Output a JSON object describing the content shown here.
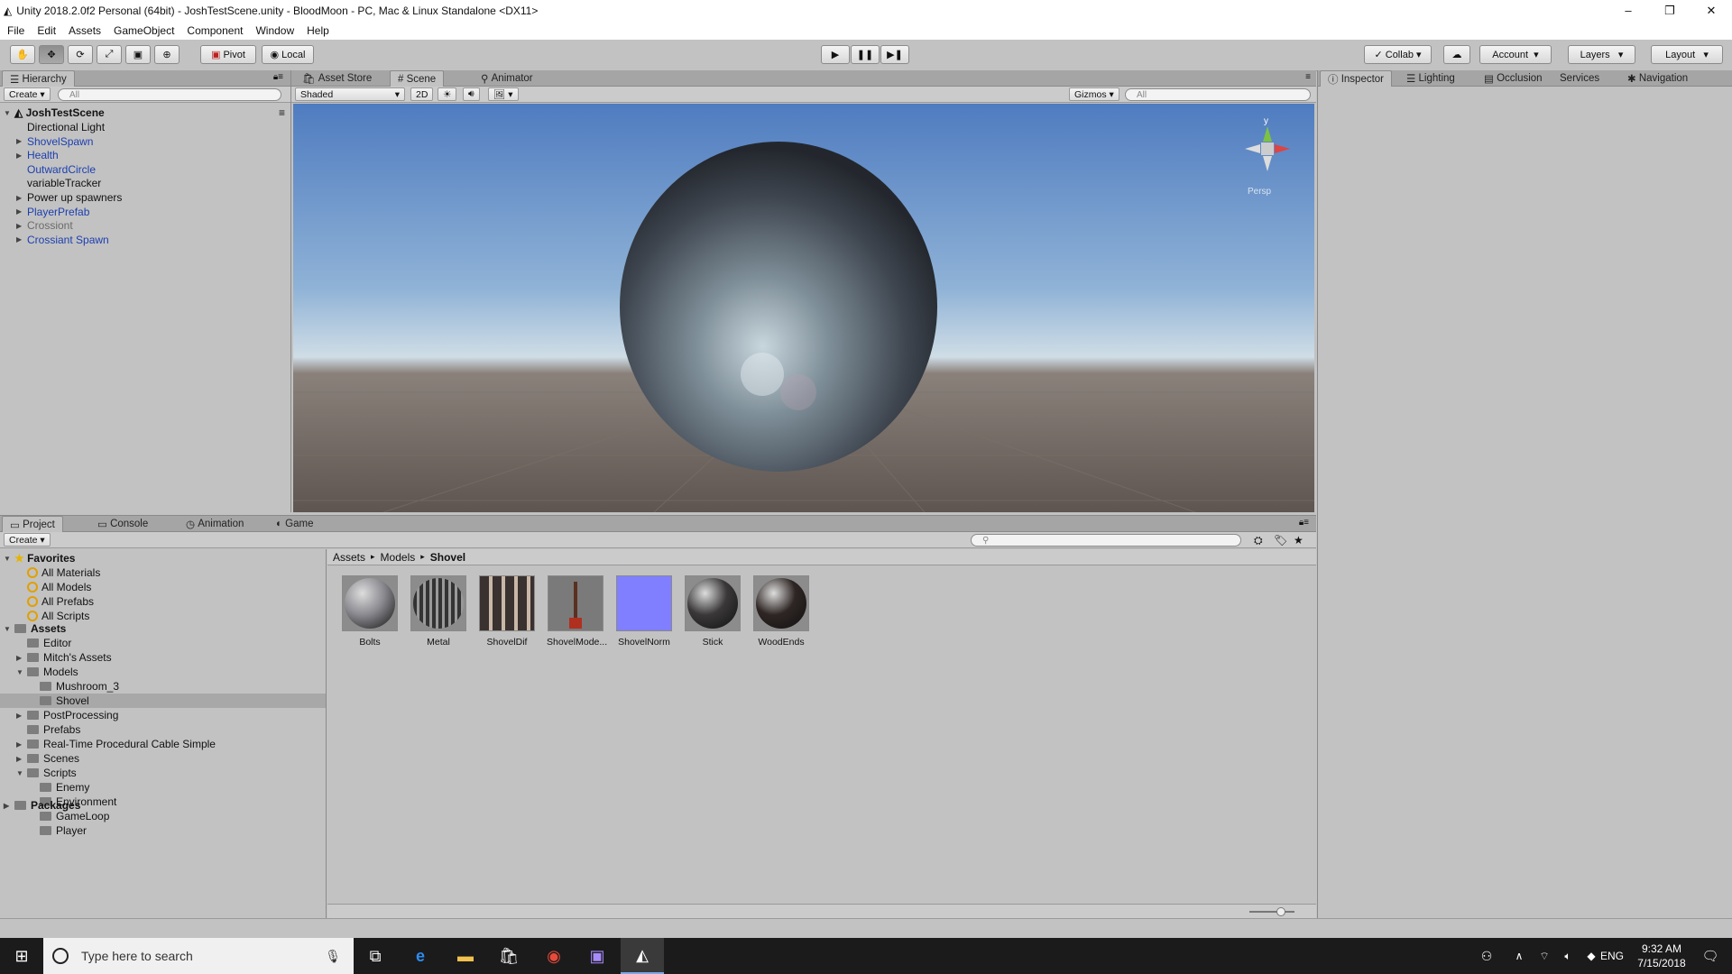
{
  "window": {
    "title": "Unity 2018.2.0f2 Personal (64bit) - JoshTestScene.unity - BloodMoon - PC, Mac & Linux Standalone <DX11>"
  },
  "menu": [
    "File",
    "Edit",
    "Assets",
    "GameObject",
    "Component",
    "Window",
    "Help"
  ],
  "toolbar": {
    "pivot": "Pivot",
    "local": "Local",
    "collab": "Collab",
    "account": "Account",
    "layers": "Layers",
    "layout": "Layout"
  },
  "hierarchy": {
    "tab": "Hierarchy",
    "create": "Create",
    "search_placeholder": "All",
    "scene": "JoshTestScene",
    "items": [
      {
        "label": "Directional Light",
        "style": "normal",
        "expand": false
      },
      {
        "label": "ShovelSpawn",
        "style": "blue",
        "expand": true
      },
      {
        "label": "Health",
        "style": "blue",
        "expand": true
      },
      {
        "label": "OutwardCircle",
        "style": "blue",
        "expand": false
      },
      {
        "label": "variableTracker",
        "style": "normal",
        "expand": false
      },
      {
        "label": "Power up spawners",
        "style": "normal",
        "expand": true
      },
      {
        "label": "PlayerPrefab",
        "style": "blue",
        "expand": true
      },
      {
        "label": "Crossiont",
        "style": "gray",
        "expand": true
      },
      {
        "label": "Crossiant Spawn",
        "style": "blue",
        "expand": true
      }
    ]
  },
  "scene_view": {
    "tabs": [
      "Asset Store",
      "Scene",
      "Animator"
    ],
    "shading": "Shaded",
    "mode_2d": "2D",
    "gizmos": "Gizmos",
    "search_placeholder": "All",
    "persp": "Persp",
    "axis_y": "y"
  },
  "inspector": {
    "tabs": [
      "Inspector",
      "Lighting",
      "Occlusion",
      "Services",
      "Navigation"
    ]
  },
  "project": {
    "tabs": [
      "Project",
      "Console",
      "Animation",
      "Game"
    ],
    "create": "Create",
    "favorites_label": "Favorites",
    "favorites": [
      "All Materials",
      "All Models",
      "All Prefabs",
      "All Scripts"
    ],
    "assets_label": "Assets",
    "tree": [
      {
        "label": "Editor",
        "depth": 1,
        "expand": ""
      },
      {
        "label": "Mitch's Assets",
        "depth": 1,
        "expand": "closed"
      },
      {
        "label": "Models",
        "depth": 1,
        "expand": "open"
      },
      {
        "label": "Mushroom_3",
        "depth": 2,
        "expand": ""
      },
      {
        "label": "Shovel",
        "depth": 2,
        "expand": "",
        "selected": true
      },
      {
        "label": "PostProcessing",
        "depth": 1,
        "expand": "closed"
      },
      {
        "label": "Prefabs",
        "depth": 1,
        "expand": ""
      },
      {
        "label": "Real-Time Procedural Cable Simple",
        "depth": 1,
        "expand": "closed"
      },
      {
        "label": "Scenes",
        "depth": 1,
        "expand": "closed"
      },
      {
        "label": "Scripts",
        "depth": 1,
        "expand": "open"
      },
      {
        "label": "Enemy",
        "depth": 2,
        "expand": ""
      },
      {
        "label": "Environment",
        "depth": 2,
        "expand": ""
      },
      {
        "label": "GameLoop",
        "depth": 2,
        "expand": ""
      },
      {
        "label": "Player",
        "depth": 2,
        "expand": ""
      }
    ],
    "packages_label": "Packages",
    "breadcrumb": [
      "Assets",
      "Models",
      "Shovel"
    ],
    "assets": [
      {
        "label": "Bolts",
        "kind": "sphere",
        "color": "#8a8a90"
      },
      {
        "label": "Metal",
        "kind": "metal",
        "color": "#5a5a5a"
      },
      {
        "label": "ShovelDif",
        "kind": "texture",
        "color": "#3a3230"
      },
      {
        "label": "ShovelMode...",
        "kind": "model",
        "color": "#6a6a6a"
      },
      {
        "label": "ShovelNorm",
        "kind": "normal",
        "color": "#7f7fff"
      },
      {
        "label": "Stick",
        "kind": "sphere",
        "color": "#3a3838"
      },
      {
        "label": "WoodEnds",
        "kind": "sphere",
        "color": "#2e2624"
      }
    ]
  },
  "taskbar": {
    "search_placeholder": "Type here to search",
    "lang": "ENG",
    "time": "9:32 AM",
    "date": "7/15/2018"
  },
  "colors": {
    "accent_blue": "#1c3fb0",
    "sky_top": "#5d86c4",
    "ground": "#6a5f58"
  }
}
